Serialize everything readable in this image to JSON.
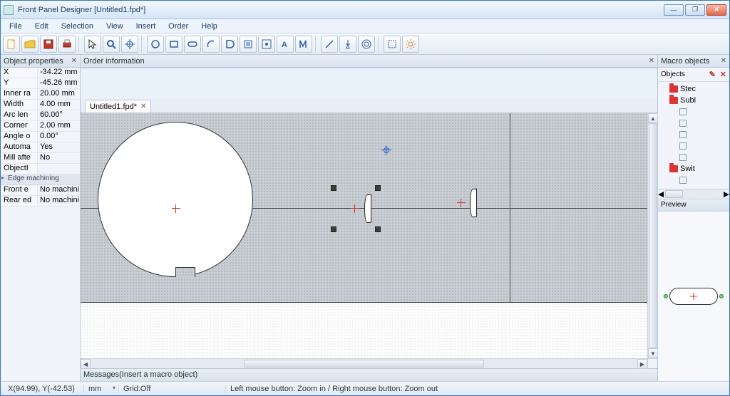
{
  "window": {
    "title": "Front Panel Designer [Untitled1.fpd*]"
  },
  "menu": [
    "File",
    "Edit",
    "Selection",
    "View",
    "Insert",
    "Order",
    "Help"
  ],
  "panels": {
    "left_title": "Object properties",
    "order_info_title": "Order information",
    "messages_title": "Messages(Insert a macro object)",
    "macro_title": "Macro objects",
    "objects_label": "Objects",
    "preview_label": "Preview"
  },
  "properties": [
    {
      "k": "X",
      "v": "-34.22 mm"
    },
    {
      "k": "Y",
      "v": "-45.26 mm"
    },
    {
      "k": "Inner ra",
      "v": "20.00 mm"
    },
    {
      "k": "Width",
      "v": "4.00 mm"
    },
    {
      "k": "Arc len",
      "v": "60.00°"
    },
    {
      "k": "Corner",
      "v": "2.00 mm"
    },
    {
      "k": "Angle o",
      "v": "0.00°"
    },
    {
      "k": "Automa",
      "v": "Yes"
    },
    {
      "k": "Mill afte",
      "v": "No"
    },
    {
      "k": "ObjectI",
      "v": ""
    }
  ],
  "prop_group": "Edge machining",
  "prop_group_rows": [
    {
      "k": "Front e",
      "v": "No machini"
    },
    {
      "k": "Rear ed",
      "v": "No machini"
    }
  ],
  "document": {
    "tab_label": "Untitled1.fpd*"
  },
  "tree": [
    {
      "depth": 1,
      "type": "folder",
      "label": "Stec"
    },
    {
      "depth": 1,
      "type": "folder",
      "label": "Subl"
    },
    {
      "depth": 2,
      "type": "leaf",
      "label": ""
    },
    {
      "depth": 2,
      "type": "leaf",
      "label": ""
    },
    {
      "depth": 2,
      "type": "leaf",
      "label": ""
    },
    {
      "depth": 2,
      "type": "leaf",
      "label": ""
    },
    {
      "depth": 2,
      "type": "leaf",
      "label": ""
    },
    {
      "depth": 1,
      "type": "folder",
      "label": "Swit"
    },
    {
      "depth": 2,
      "type": "leaf",
      "label": ""
    }
  ],
  "status": {
    "coords": "X(94.99), Y(-42.53)",
    "unit": "mm",
    "grid": "Grid:Off",
    "hint": "Left mouse button: Zoom in /  Right mouse button: Zoom out"
  },
  "colors": {
    "accent": "#1b3d62",
    "danger": "#c0392b"
  }
}
